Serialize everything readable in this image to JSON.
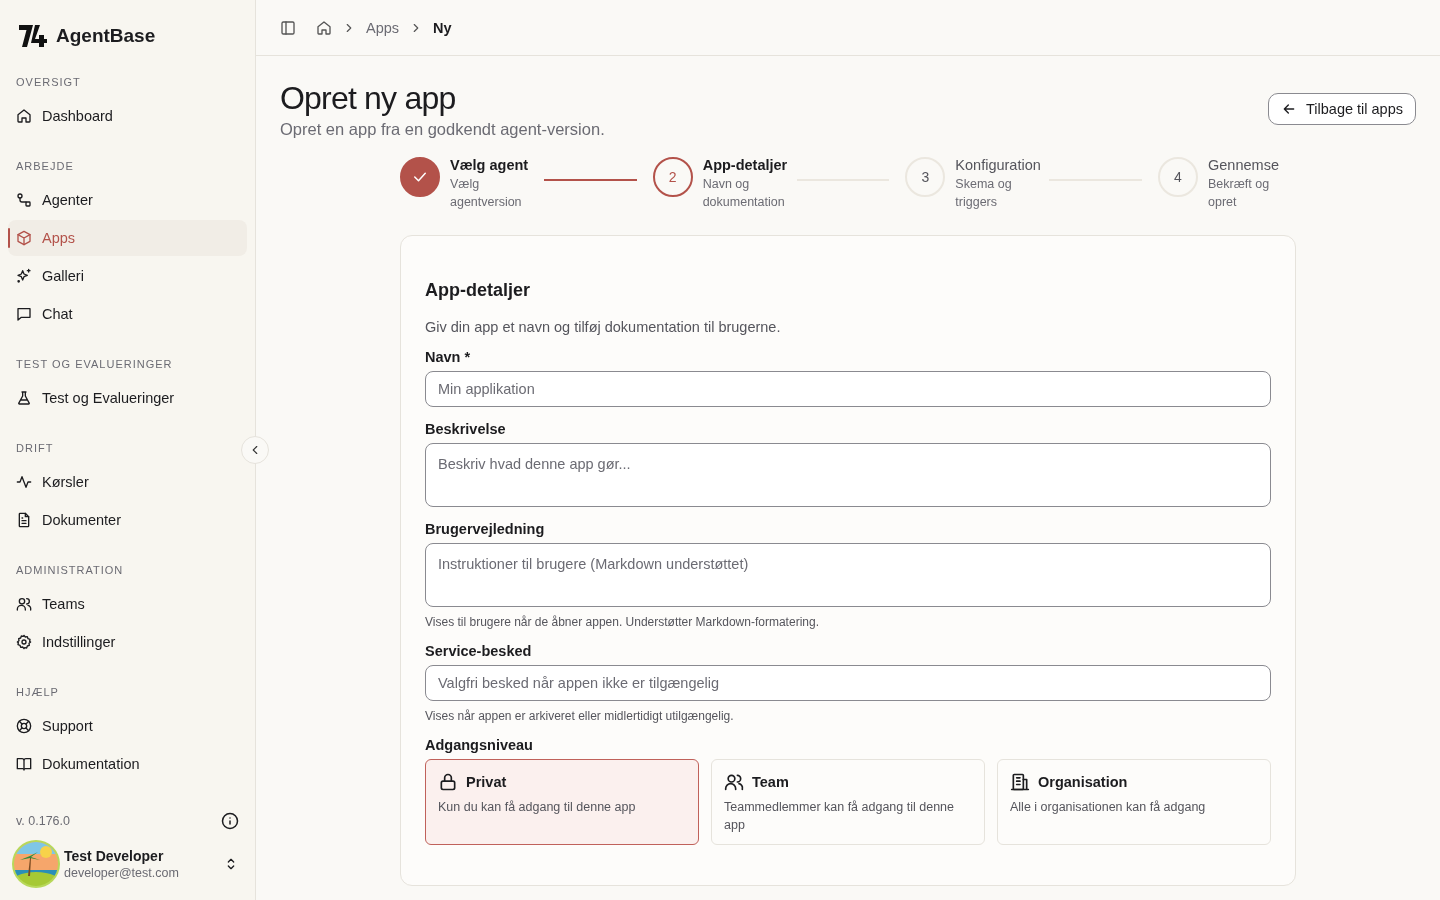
{
  "sidebar": {
    "brand": "AgentBase",
    "sections": [
      {
        "label": "OVERSIGT",
        "items": [
          {
            "label": "Dashboard",
            "selected": false
          }
        ]
      },
      {
        "label": "ARBEJDE",
        "items": [
          {
            "label": "Agenter",
            "selected": false
          },
          {
            "label": "Apps",
            "selected": true
          },
          {
            "label": "Galleri",
            "selected": false
          },
          {
            "label": "Chat",
            "selected": false
          }
        ]
      },
      {
        "label": "TEST OG EVALUERINGER",
        "items": [
          {
            "label": "Test og Evalueringer",
            "selected": false
          }
        ]
      },
      {
        "label": "DRIFT",
        "items": [
          {
            "label": "Kørsler",
            "selected": false
          },
          {
            "label": "Dokumenter",
            "selected": false
          }
        ]
      },
      {
        "label": "ADMINISTRATION",
        "items": [
          {
            "label": "Teams",
            "selected": false
          },
          {
            "label": "Indstillinger",
            "selected": false
          }
        ]
      },
      {
        "label": "HJÆLP",
        "items": [
          {
            "label": "Support",
            "selected": false
          },
          {
            "label": "Dokumentation",
            "selected": false
          }
        ]
      }
    ],
    "version": "v. 0.176.0",
    "user": {
      "name": "Test Developer",
      "email": "developer@test.com"
    }
  },
  "breadcrumb": [
    "Apps",
    "Ny"
  ],
  "page": {
    "title": "Opret ny app",
    "subtitle": "Opret en app fra en godkendt agent-version.",
    "back_button": "Tilbage til apps"
  },
  "steps": [
    {
      "title": "Vælg agent",
      "subtitle": "Vælg agentversion",
      "completed": true,
      "selected": false
    },
    {
      "number": "2",
      "title": "App-detaljer",
      "subtitle": "Navn og dokumentation",
      "completed": false,
      "selected": true
    },
    {
      "number": "3",
      "title": "Konfiguration",
      "subtitle": "Skema og triggers",
      "completed": false,
      "selected": false
    },
    {
      "number": "4",
      "title": "Gennemse",
      "subtitle": "Bekræft og opret",
      "completed": false,
      "selected": false
    }
  ],
  "form": {
    "title": "App-detaljer",
    "description": "Giv din app et navn og tilføj dokumentation til brugerne.",
    "fields": [
      {
        "kind": "input",
        "label": "Navn *",
        "placeholder": "Min applikation"
      },
      {
        "kind": "textarea",
        "label": "Beskrivelse",
        "placeholder": "Beskriv hvad denne app gør..."
      },
      {
        "kind": "textarea",
        "label": "Brugervejledning",
        "placeholder": "Instruktioner til brugere (Markdown understøttet)",
        "hint": "Vises til brugere når de åbner appen. Understøtter Markdown-formatering."
      },
      {
        "kind": "input",
        "label": "Service-besked",
        "placeholder": "Valgfri besked når appen ikke er tilgængelig",
        "hint": "Vises når appen er arkiveret eller midlertidigt utilgængelig."
      }
    ],
    "access": {
      "label": "Adgangsniveau",
      "options": [
        {
          "title": "Privat",
          "description": "Kun du kan få adgang til denne app",
          "selected": true
        },
        {
          "title": "Team",
          "description": "Teammedlemmer kan få adgang til denne app",
          "selected": false
        },
        {
          "title": "Organisation",
          "description": "Alle i organisationen kan få adgang",
          "selected": false
        }
      ]
    }
  }
}
